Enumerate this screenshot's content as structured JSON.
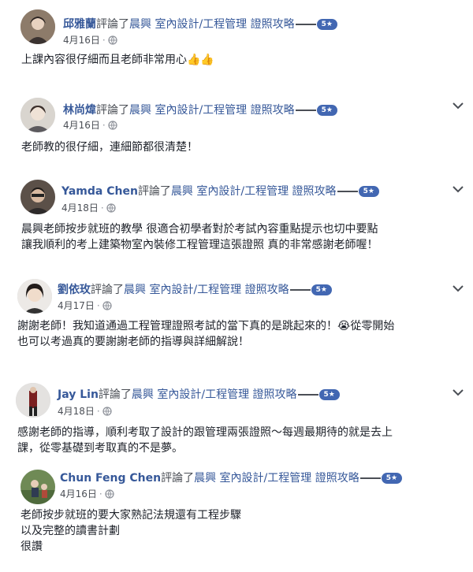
{
  "accent_color": "#365899",
  "rating_color": "#4267b2",
  "reviews": [
    {
      "name": "邱雅蘭",
      "verb": "評論了",
      "page": "晨興 室內設計/工程管理 證照攻略",
      "rating": "5★",
      "date": "4月16日",
      "lines": [
        "上課內容很仔細而且老師非常用心👍👍"
      ],
      "avatar_icon": "user-avatar"
    },
    {
      "name": "林尚煒",
      "verb": "評論了",
      "page": "晨興 室內設計/工程管理 證照攻略",
      "rating": "5★",
      "date": "4月16日",
      "lines": [
        "老師教的很仔細，連細節都很清楚！"
      ],
      "avatar_icon": "user-avatar"
    },
    {
      "name": "Yamda Chen",
      "verb": "評論了",
      "page": "晨興 室內設計/工程管理 證照攻略",
      "rating": "5★",
      "date": "4月18日",
      "lines": [
        "晨興老師按步就班的教學 很適合初學者對於考試內容重點提示也切中要點",
        "讓我順利的考上建築物室內裝修工程管理這張證照 真的非常感謝老師喔！"
      ],
      "avatar_icon": "user-avatar"
    },
    {
      "name": "劉依玫",
      "verb": "評論了",
      "page": "晨興 室內設計/工程管理 證照攻略",
      "rating": "5★",
      "date": "4月17日",
      "lines": [
        "謝謝老師！我知道通過工程管理證照考試的當下真的是跳起來的！😭從零開始",
        "也可以考過真的要謝謝老師的指導與詳細解說！"
      ],
      "avatar_icon": "user-avatar"
    },
    {
      "name": "Jay Lin",
      "verb": "評論了",
      "page": "晨興 室內設計/工程管理 證照攻略",
      "rating": "5★",
      "date": "4月18日",
      "lines": [
        "感謝老師的指導，順利考取了設計的跟管理兩張證照～每週最期待的就是去上",
        "課，從零基礎到考取真的不是夢。"
      ],
      "avatar_icon": "user-avatar"
    },
    {
      "name": "Chun Feng Chen",
      "verb": "評論了",
      "page": "晨興 室內設計/工程管理 證照攻略",
      "rating": "5★",
      "date": "4月16日",
      "lines": [
        "老師按步就班的要大家熟記法規還有工程步驟",
        "以及完整的讀書計劃",
        "很讚"
      ],
      "avatar_icon": "user-avatar"
    }
  ],
  "meta_separator": "·",
  "privacy_icon": "globe-icon",
  "menu_icon": "chevron-down-icon"
}
